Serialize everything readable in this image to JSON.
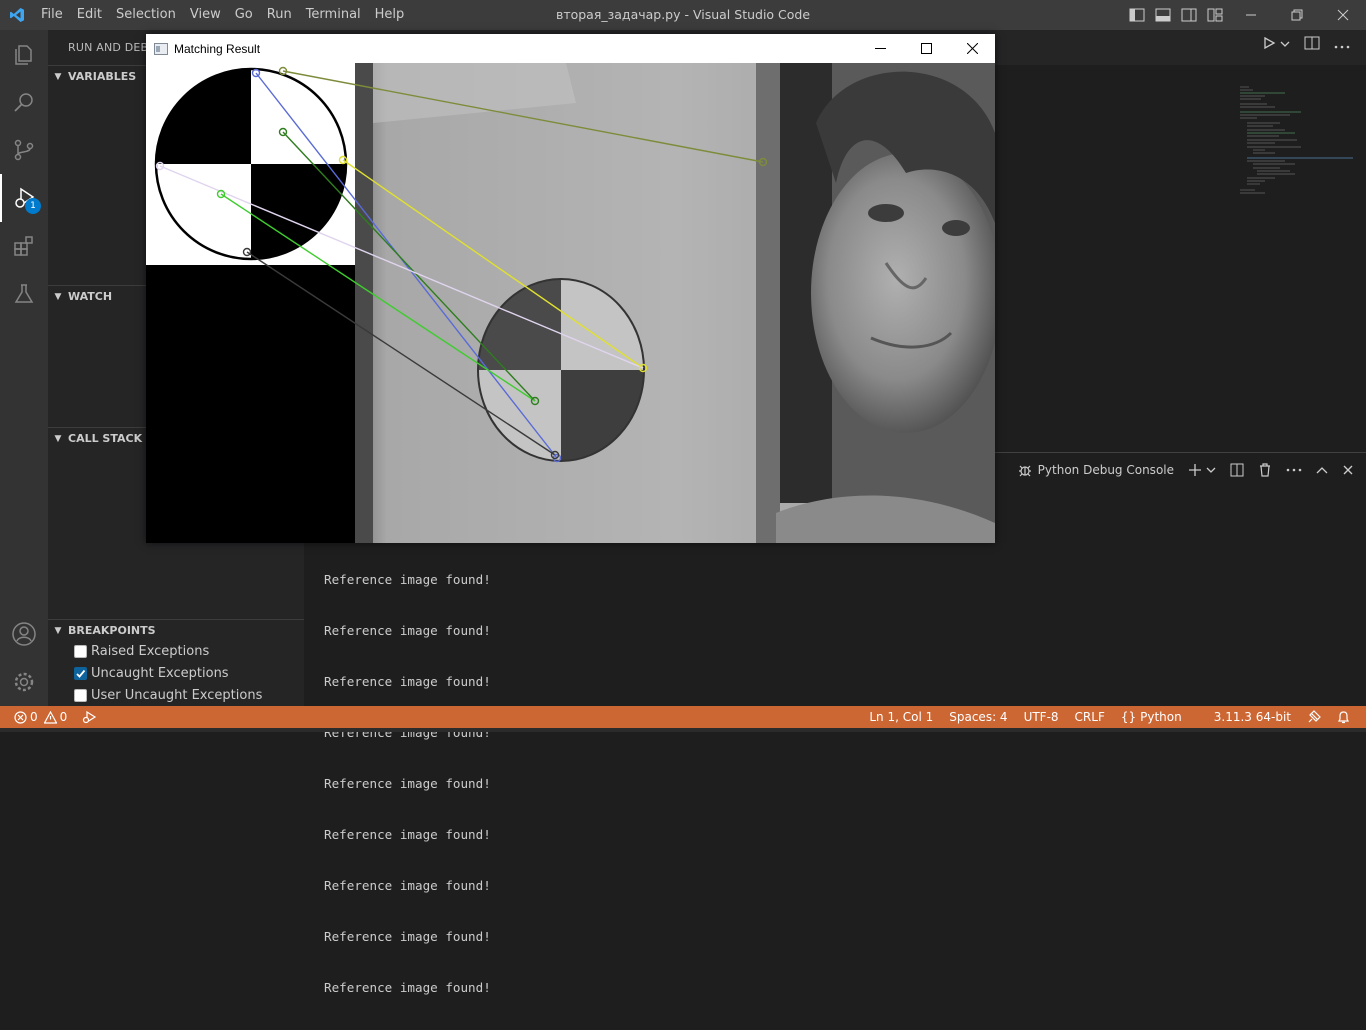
{
  "window": {
    "title": "вторая_задачар.py - Visual Studio Code"
  },
  "menu": [
    "File",
    "Edit",
    "Selection",
    "View",
    "Go",
    "Run",
    "Terminal",
    "Help"
  ],
  "activity": {
    "debug_badge": "1",
    "items": [
      "explorer-icon",
      "search-icon",
      "source-control-icon",
      "run-debug-icon",
      "extensions-icon",
      "testing-icon",
      "account-icon",
      "settings-gear-icon"
    ]
  },
  "sidebar": {
    "header": "RUN AND DEBU",
    "sections": {
      "variables": "VARIABLES",
      "watch": "WATCH",
      "call_stack": "CALL STACK",
      "breakpoints": "BREAKPOINTS"
    },
    "breakpoints": [
      {
        "label": "Raised Exceptions",
        "checked": false
      },
      {
        "label": "Uncaught Exceptions",
        "checked": true
      },
      {
        "label": "User Uncaught Exceptions",
        "checked": false
      }
    ]
  },
  "panel": {
    "console_name": "Python Debug Console",
    "lines": [
      "Reference image found!",
      "Reference image found!",
      "Reference image found!",
      "Reference image found!",
      "Reference image found!",
      "Reference image found!",
      "Reference image found!",
      "Reference image found!",
      "Reference image found!"
    ]
  },
  "status": {
    "errors": "0",
    "warnings": "0",
    "position": "Ln 1, Col 1",
    "spaces": "Spaces: 4",
    "encoding": "UTF-8",
    "eol": "CRLF",
    "language": "Python",
    "interpreter": "3.11.3 64-bit",
    "bg_color": "#cc6633"
  },
  "matching_window": {
    "title": "Matching Result"
  }
}
